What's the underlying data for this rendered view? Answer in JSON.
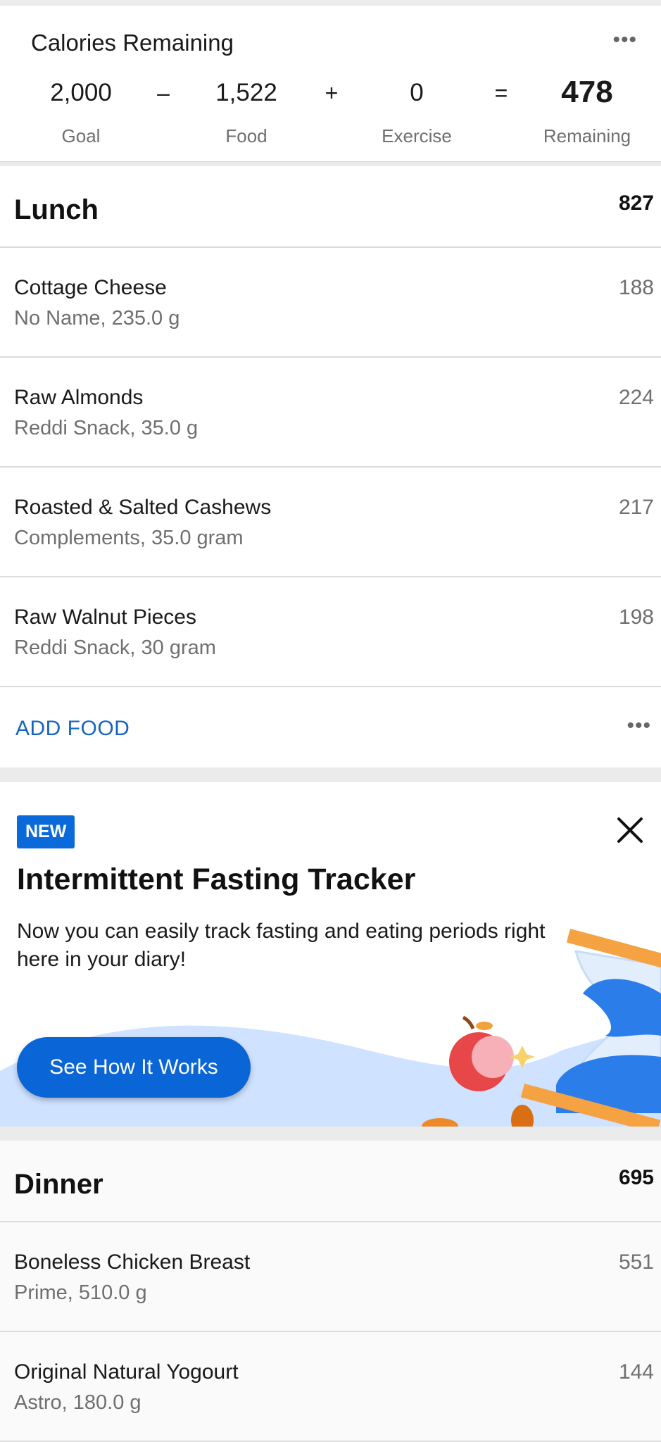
{
  "summary": {
    "title": "Calories Remaining",
    "goal_value": "2,000",
    "goal_label": "Goal",
    "minus": "–",
    "food_value": "1,522",
    "food_label": "Food",
    "plus": "+",
    "exercise_value": "0",
    "exercise_label": "Exercise",
    "equals": "=",
    "remaining_value": "478",
    "remaining_label": "Remaining",
    "menu_icon": "more-horizontal-icon"
  },
  "lunch": {
    "name": "Lunch",
    "total": "827",
    "items": [
      {
        "name": "Cottage Cheese",
        "desc": "No Name, 235.0 g",
        "cal": "188"
      },
      {
        "name": "Raw Almonds",
        "desc": "Reddi Snack, 35.0 g",
        "cal": "224"
      },
      {
        "name": "Roasted & Salted Cashews",
        "desc": "Complements, 35.0 gram",
        "cal": "217"
      },
      {
        "name": "Raw Walnut Pieces",
        "desc": "Reddi Snack, 30 gram",
        "cal": "198"
      }
    ],
    "add_label": "ADD FOOD"
  },
  "promo": {
    "badge": "NEW",
    "title": "Intermittent Fasting Tracker",
    "body": "Now you can easily track fasting and eating periods right here in your diary!",
    "button": "See How It Works",
    "close_icon": "close-icon"
  },
  "dinner": {
    "name": "Dinner",
    "total": "695",
    "items": [
      {
        "name": "Boneless Chicken Breast",
        "desc": "Prime, 510.0 g",
        "cal": "551"
      },
      {
        "name": "Original Natural Yogourt",
        "desc": "Astro, 180.0 g",
        "cal": "144"
      }
    ]
  },
  "colors": {
    "accent": "#0a6ad9",
    "link": "#1565c0",
    "divider": "#dcdcdc",
    "background": "#ebebeb"
  }
}
